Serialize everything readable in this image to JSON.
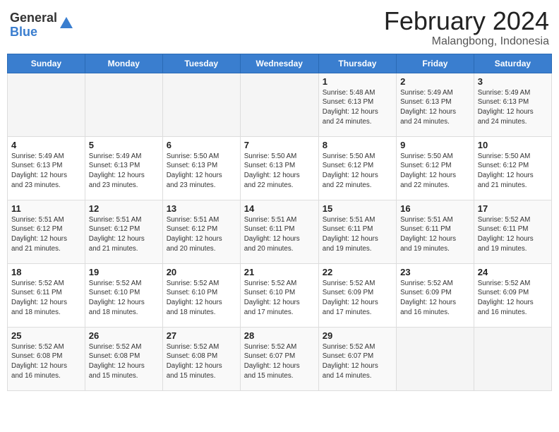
{
  "header": {
    "logo_general": "General",
    "logo_blue": "Blue",
    "month_title": "February 2024",
    "location": "Malangbong, Indonesia"
  },
  "days_of_week": [
    "Sunday",
    "Monday",
    "Tuesday",
    "Wednesday",
    "Thursday",
    "Friday",
    "Saturday"
  ],
  "weeks": [
    [
      {
        "day": "",
        "info": ""
      },
      {
        "day": "",
        "info": ""
      },
      {
        "day": "",
        "info": ""
      },
      {
        "day": "",
        "info": ""
      },
      {
        "day": "1",
        "info": "Sunrise: 5:48 AM\nSunset: 6:13 PM\nDaylight: 12 hours\nand 24 minutes."
      },
      {
        "day": "2",
        "info": "Sunrise: 5:49 AM\nSunset: 6:13 PM\nDaylight: 12 hours\nand 24 minutes."
      },
      {
        "day": "3",
        "info": "Sunrise: 5:49 AM\nSunset: 6:13 PM\nDaylight: 12 hours\nand 24 minutes."
      }
    ],
    [
      {
        "day": "4",
        "info": "Sunrise: 5:49 AM\nSunset: 6:13 PM\nDaylight: 12 hours\nand 23 minutes."
      },
      {
        "day": "5",
        "info": "Sunrise: 5:49 AM\nSunset: 6:13 PM\nDaylight: 12 hours\nand 23 minutes."
      },
      {
        "day": "6",
        "info": "Sunrise: 5:50 AM\nSunset: 6:13 PM\nDaylight: 12 hours\nand 23 minutes."
      },
      {
        "day": "7",
        "info": "Sunrise: 5:50 AM\nSunset: 6:13 PM\nDaylight: 12 hours\nand 22 minutes."
      },
      {
        "day": "8",
        "info": "Sunrise: 5:50 AM\nSunset: 6:12 PM\nDaylight: 12 hours\nand 22 minutes."
      },
      {
        "day": "9",
        "info": "Sunrise: 5:50 AM\nSunset: 6:12 PM\nDaylight: 12 hours\nand 22 minutes."
      },
      {
        "day": "10",
        "info": "Sunrise: 5:50 AM\nSunset: 6:12 PM\nDaylight: 12 hours\nand 21 minutes."
      }
    ],
    [
      {
        "day": "11",
        "info": "Sunrise: 5:51 AM\nSunset: 6:12 PM\nDaylight: 12 hours\nand 21 minutes."
      },
      {
        "day": "12",
        "info": "Sunrise: 5:51 AM\nSunset: 6:12 PM\nDaylight: 12 hours\nand 21 minutes."
      },
      {
        "day": "13",
        "info": "Sunrise: 5:51 AM\nSunset: 6:12 PM\nDaylight: 12 hours\nand 20 minutes."
      },
      {
        "day": "14",
        "info": "Sunrise: 5:51 AM\nSunset: 6:11 PM\nDaylight: 12 hours\nand 20 minutes."
      },
      {
        "day": "15",
        "info": "Sunrise: 5:51 AM\nSunset: 6:11 PM\nDaylight: 12 hours\nand 19 minutes."
      },
      {
        "day": "16",
        "info": "Sunrise: 5:51 AM\nSunset: 6:11 PM\nDaylight: 12 hours\nand 19 minutes."
      },
      {
        "day": "17",
        "info": "Sunrise: 5:52 AM\nSunset: 6:11 PM\nDaylight: 12 hours\nand 19 minutes."
      }
    ],
    [
      {
        "day": "18",
        "info": "Sunrise: 5:52 AM\nSunset: 6:11 PM\nDaylight: 12 hours\nand 18 minutes."
      },
      {
        "day": "19",
        "info": "Sunrise: 5:52 AM\nSunset: 6:10 PM\nDaylight: 12 hours\nand 18 minutes."
      },
      {
        "day": "20",
        "info": "Sunrise: 5:52 AM\nSunset: 6:10 PM\nDaylight: 12 hours\nand 18 minutes."
      },
      {
        "day": "21",
        "info": "Sunrise: 5:52 AM\nSunset: 6:10 PM\nDaylight: 12 hours\nand 17 minutes."
      },
      {
        "day": "22",
        "info": "Sunrise: 5:52 AM\nSunset: 6:09 PM\nDaylight: 12 hours\nand 17 minutes."
      },
      {
        "day": "23",
        "info": "Sunrise: 5:52 AM\nSunset: 6:09 PM\nDaylight: 12 hours\nand 16 minutes."
      },
      {
        "day": "24",
        "info": "Sunrise: 5:52 AM\nSunset: 6:09 PM\nDaylight: 12 hours\nand 16 minutes."
      }
    ],
    [
      {
        "day": "25",
        "info": "Sunrise: 5:52 AM\nSunset: 6:08 PM\nDaylight: 12 hours\nand 16 minutes."
      },
      {
        "day": "26",
        "info": "Sunrise: 5:52 AM\nSunset: 6:08 PM\nDaylight: 12 hours\nand 15 minutes."
      },
      {
        "day": "27",
        "info": "Sunrise: 5:52 AM\nSunset: 6:08 PM\nDaylight: 12 hours\nand 15 minutes."
      },
      {
        "day": "28",
        "info": "Sunrise: 5:52 AM\nSunset: 6:07 PM\nDaylight: 12 hours\nand 15 minutes."
      },
      {
        "day": "29",
        "info": "Sunrise: 5:52 AM\nSunset: 6:07 PM\nDaylight: 12 hours\nand 14 minutes."
      },
      {
        "day": "",
        "info": ""
      },
      {
        "day": "",
        "info": ""
      }
    ]
  ]
}
